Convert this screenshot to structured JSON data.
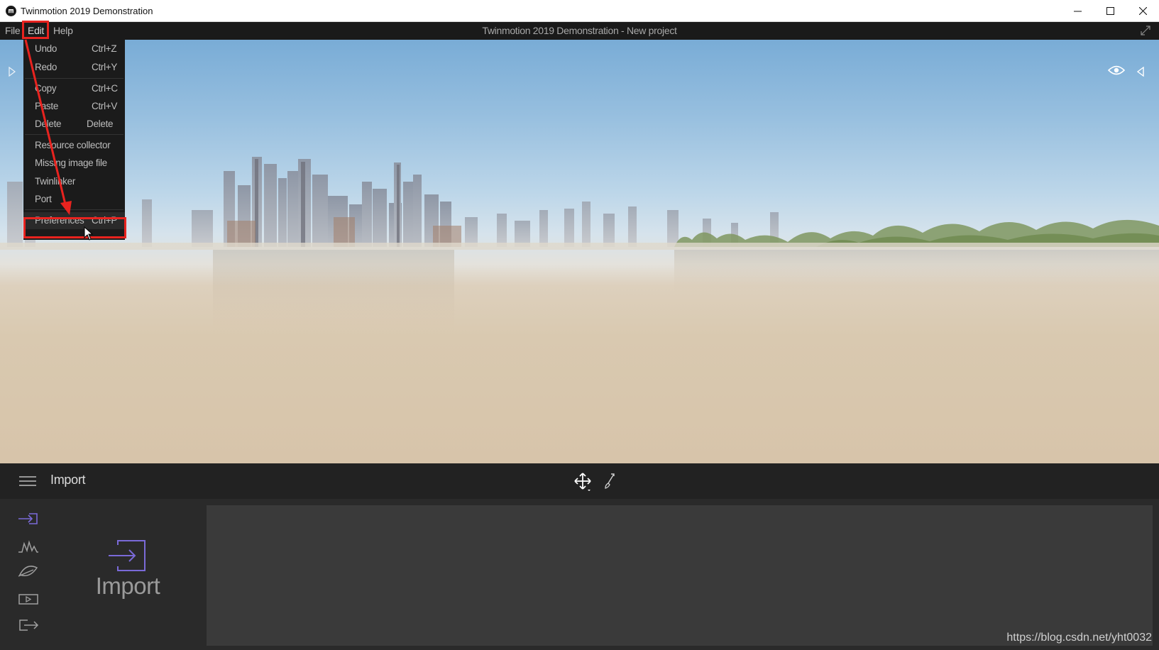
{
  "window": {
    "title": "Twinmotion 2019 Demonstration",
    "controls": [
      "minimize-icon",
      "maximize-icon",
      "close-icon"
    ]
  },
  "menubar": {
    "items": [
      {
        "label": "File"
      },
      {
        "label": "Edit"
      },
      {
        "label": "Help"
      }
    ],
    "project_title": "Twinmotion 2019 Demonstration - New project"
  },
  "edit_menu": {
    "items": [
      {
        "label": "Undo",
        "shortcut": "Ctrl+Z"
      },
      {
        "label": "Redo",
        "shortcut": "Ctrl+Y"
      },
      {
        "label": "Copy",
        "shortcut": "Ctrl+C"
      },
      {
        "label": "Paste",
        "shortcut": "Ctrl+V"
      },
      {
        "label": "Delete",
        "shortcut": "Delete"
      },
      {
        "label": "Resource collector",
        "shortcut": ""
      },
      {
        "label": "Missing image file",
        "shortcut": ""
      },
      {
        "label": "Twinlinker",
        "shortcut": ""
      },
      {
        "label": "Port",
        "shortcut": ""
      },
      {
        "label": "Preferences",
        "shortcut": "Ctrl+P"
      }
    ],
    "highlighted_item": "Preferences",
    "annotation_color": "#e8231f"
  },
  "toolbar": {
    "title": "Import"
  },
  "panel": {
    "sidebar_icons": [
      "import-icon",
      "context-icon",
      "settings-icon",
      "media-icon",
      "export-icon"
    ],
    "active_icon": "import-icon",
    "accent_color": "#7a6ad8",
    "section_label": "Import"
  },
  "watermark": "https://blog.csdn.net/yht0032"
}
